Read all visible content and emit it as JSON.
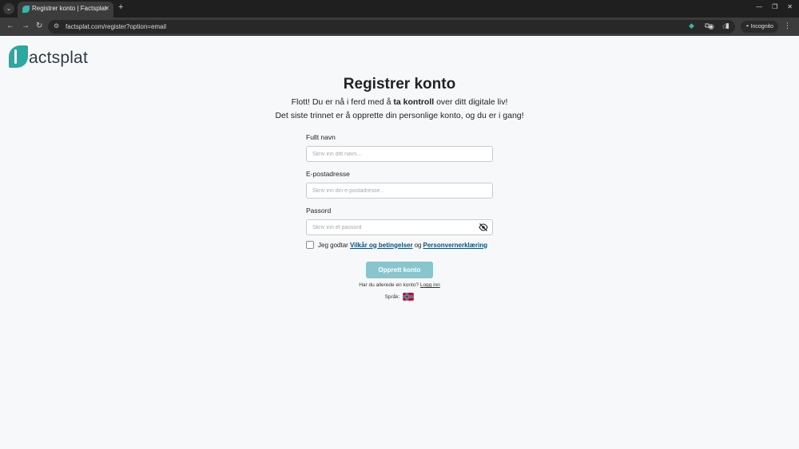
{
  "browser": {
    "tab_title": "Registrer konto | Factsplat",
    "url": "factsplat.com/register?option=email",
    "incognito_label": "Incognito"
  },
  "page": {
    "logo_text": "actsplat",
    "title": "Registrer konto",
    "subtitle1": {
      "before": "Flott! Du er nå i ferd med å ",
      "bold": "ta kontroll",
      "after": " over ditt digitale liv!"
    },
    "subtitle2": "Det siste trinnet er å opprette din personlige konto, og du er i gang!",
    "form": {
      "name_label": "Fullt navn",
      "name_placeholder": "Skriv inn ditt navn...",
      "email_label": "E-postadresse",
      "email_placeholder": "Skriv inn din e-postadresse...",
      "password_label": "Passord",
      "password_placeholder": "Skriv inn et passord",
      "terms_prefix": "Jeg godtar",
      "terms_link": "Vilkår og betingelser",
      "terms_and": "og",
      "privacy_link": "Personvernerklæring",
      "submit_label": "Opprett konto"
    },
    "login": {
      "text": "Har du allerede en konto?",
      "link": "Logg inn"
    },
    "language": {
      "label": "Språk:",
      "flag": "norway-flag-icon"
    },
    "colors": {
      "brand": "#2ba8a0",
      "button": "#89c5cd",
      "link": "#0d4f75"
    }
  }
}
